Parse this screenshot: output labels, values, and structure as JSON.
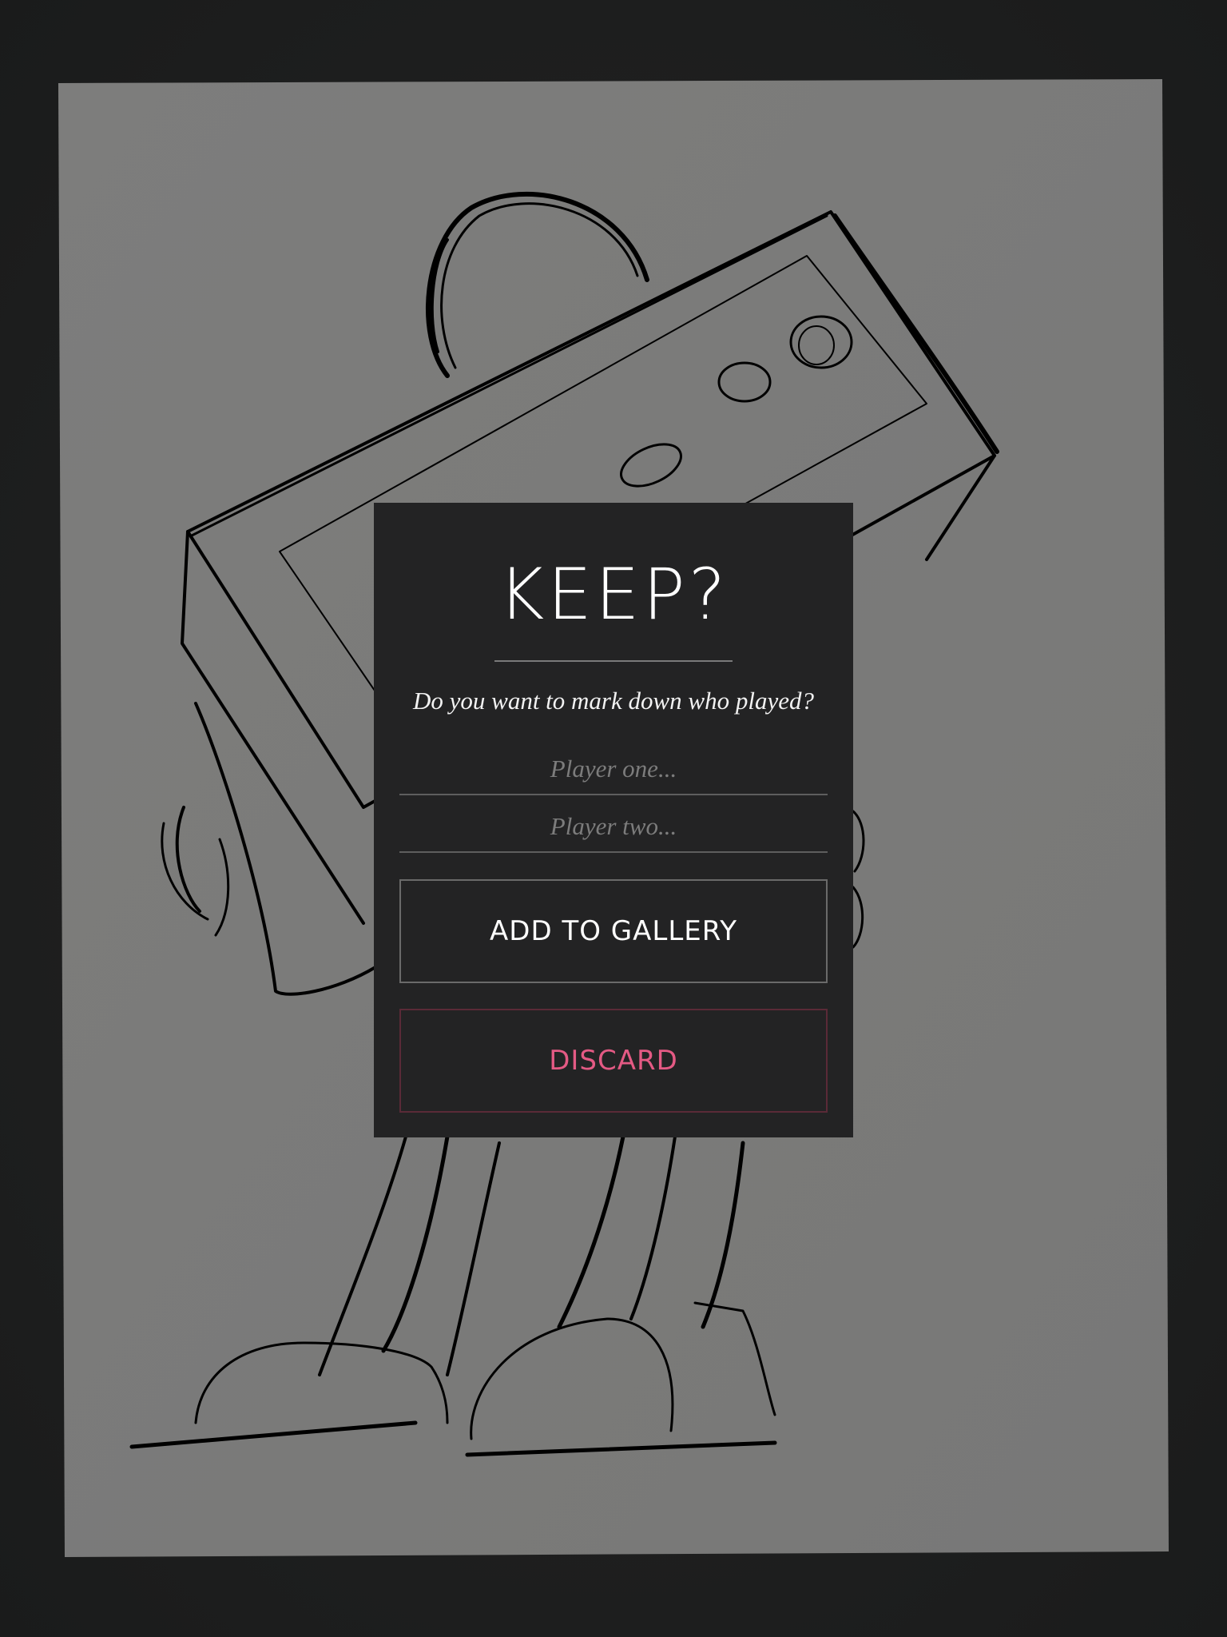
{
  "dialog": {
    "title": "KEEP?",
    "prompt": "Do you want to mark down who played?",
    "player_one": {
      "value": "",
      "placeholder": "Player one..."
    },
    "player_two": {
      "value": "",
      "placeholder": "Player two..."
    },
    "add_to_gallery_label": "ADD TO GALLERY",
    "discard_label": "DISCARD"
  },
  "colors": {
    "background": "#1c1d1d",
    "paper": "#7b7b7a",
    "dialog": "#232324",
    "discard_accent": "#e45a84",
    "ink": "#000000"
  }
}
